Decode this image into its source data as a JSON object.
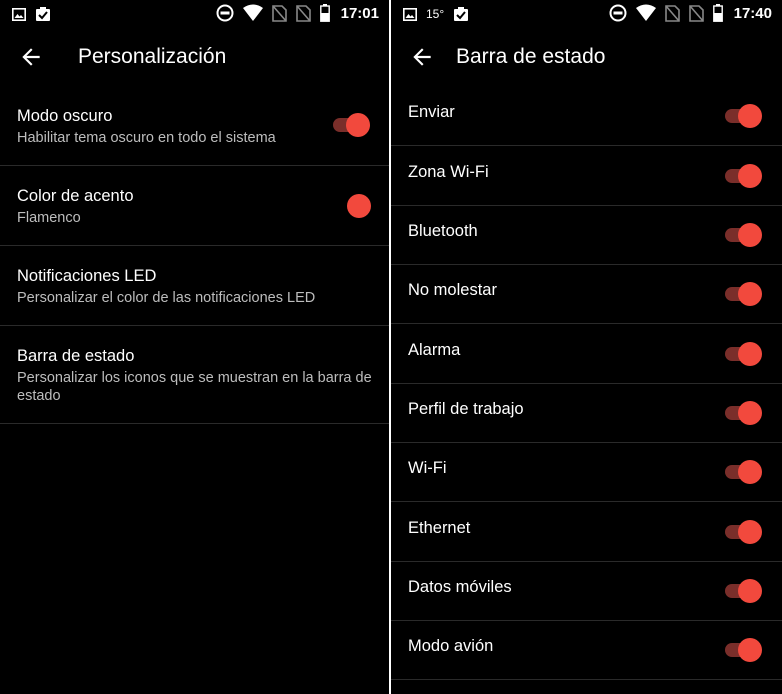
{
  "colors": {
    "accent": "#f2493d",
    "track": "#7a2e2a",
    "background": "#000000"
  },
  "left": {
    "status": {
      "time": "17:01",
      "icons": [
        "image-icon",
        "clipboard-check-icon",
        "dnd-icon",
        "wifi-icon",
        "no-sim-icon",
        "no-sim-icon",
        "battery-icon"
      ]
    },
    "title": "Personalización",
    "items": [
      {
        "title": "Modo oscuro",
        "subtitle": "Habilitar tema oscuro en todo el sistema",
        "control": "switch",
        "checked": true
      },
      {
        "title": "Color de acento",
        "subtitle": "Flamenco",
        "control": "color-dot"
      },
      {
        "title": "Notificaciones LED",
        "subtitle": "Personalizar el color de las notificaciones LED"
      },
      {
        "title": "Barra de estado",
        "subtitle": "Personalizar los iconos que se muestran en la barra de estado"
      }
    ]
  },
  "right": {
    "status": {
      "temp": "15°",
      "time": "17:40",
      "icons": [
        "image-icon",
        "clipboard-check-icon",
        "dnd-icon",
        "wifi-icon",
        "no-sim-icon",
        "no-sim-icon",
        "battery-icon"
      ]
    },
    "title": "Barra de estado",
    "items": [
      {
        "label": "Enviar",
        "checked": true
      },
      {
        "label": "Zona Wi-Fi",
        "checked": true
      },
      {
        "label": "Bluetooth",
        "checked": true
      },
      {
        "label": "No molestar",
        "checked": true
      },
      {
        "label": "Alarma",
        "checked": true
      },
      {
        "label": "Perfil de trabajo",
        "checked": true
      },
      {
        "label": "Wi-Fi",
        "checked": true
      },
      {
        "label": "Ethernet",
        "checked": true
      },
      {
        "label": "Datos móviles",
        "checked": true
      },
      {
        "label": "Modo avión",
        "checked": true
      }
    ]
  }
}
